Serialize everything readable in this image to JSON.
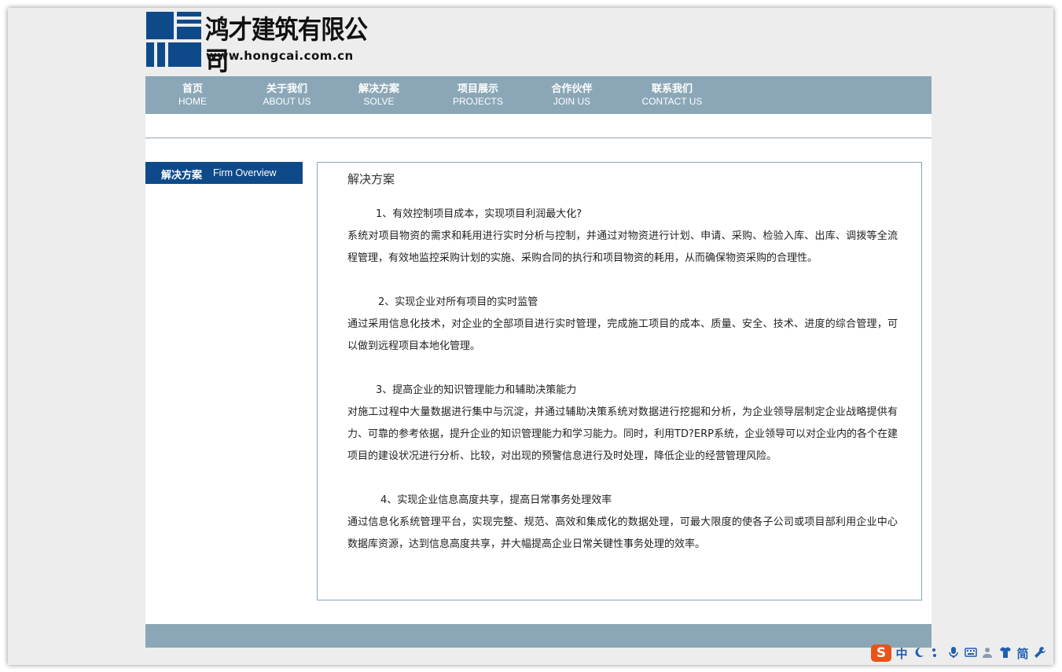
{
  "colors": {
    "nav_bg": "#8ba7b7",
    "side_head_bg": "#0e4a8a",
    "logo_blue": "#0e4a8a"
  },
  "logo": {
    "name": "鸿才建筑有限公司",
    "url": "www.hongcai.com.cn"
  },
  "nav": [
    {
      "cn": "首页",
      "en": "HOME"
    },
    {
      "cn": "关于我们",
      "en": "ABOUT US"
    },
    {
      "cn": "解决方案",
      "en": "SOLVE"
    },
    {
      "cn": "项目展示",
      "en": "PROJECTS"
    },
    {
      "cn": "合作伙伴",
      "en": "JOIN US"
    },
    {
      "cn": "联系我们",
      "en": "CONTACT US"
    }
  ],
  "sidebar": {
    "title_cn": "解决方案",
    "title_en": "Firm Overview"
  },
  "content": {
    "title": "解决方案",
    "sections": [
      {
        "heading": "1、有效控制项目成本，实现项目利润最大化?",
        "text": "系统对项目物资的需求和耗用进行实时分析与控制，并通过对物资进行计划、申请、采购、检验入库、出库、调拨等全流程管理，有效地监控采购计划的实施、采购合同的执行和项目物资的耗用，从而确保物资采购的合理性。"
      },
      {
        "heading": "2、实现企业对所有项目的实时监管",
        "text": "通过采用信息化技术，对企业的全部项目进行实时管理，完成施工项目的成本、质量、安全、技术、进度的综合管理，可以做到远程项目本地化管理。"
      },
      {
        "heading": "3、提高企业的知识管理能力和辅助决策能力",
        "text": "对施工过程中大量数据进行集中与沉淀，并通过辅助决策系统对数据进行挖掘和分析，为企业领导层制定企业战略提供有力、可靠的参考依据，提升企业的知识管理能力和学习能力。同时，利用TD?ERP系统，企业领导可以对企业内的各个在建项目的建设状况进行分析、比较，对出现的预警信息进行及时处理，降低企业的经营管理风险。"
      },
      {
        "heading": "4、实现企业信息高度共享，提高日常事务处理效率",
        "text": "通过信息化系统管理平台，实现完整、规范、高效和集成化的数据处理，可最大限度的使各子公司或项目部利用企业中心数据库资源，达到信息高度共享，并大幅提高企业日常关键性事务处理的效率。"
      }
    ]
  },
  "ime": {
    "logo": "S",
    "mode": "中",
    "simplified": "简",
    "icons": [
      "moon-icon",
      "punctuation-icon",
      "microphone-icon",
      "keyboard-icon",
      "user-icon",
      "skin-icon",
      "wrench-icon"
    ]
  }
}
